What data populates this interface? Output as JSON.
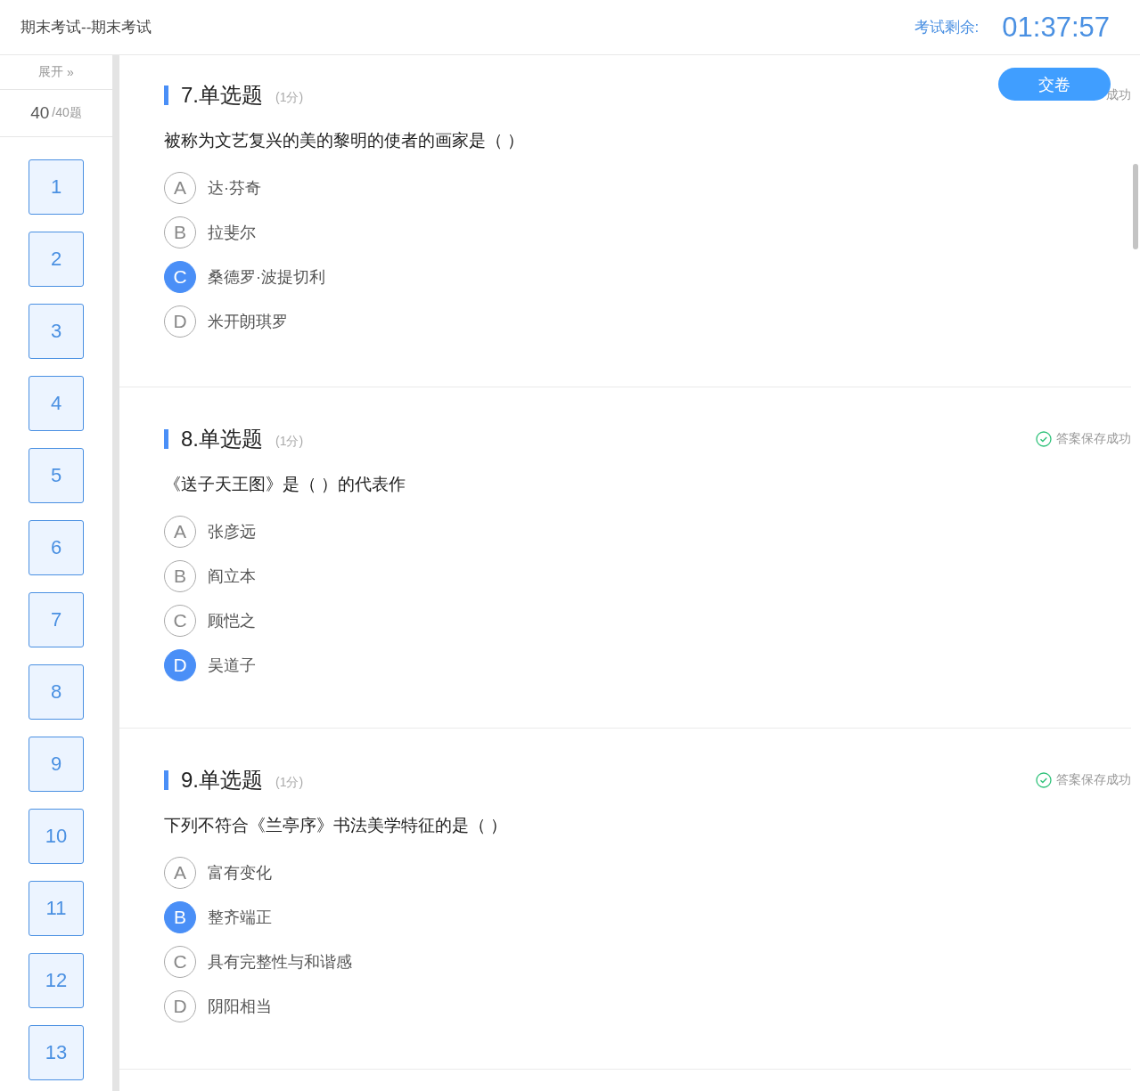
{
  "header": {
    "title": "期末考试--期末考试",
    "timer_label": "考试剩余:",
    "timer": "01:37:57"
  },
  "sidebar": {
    "expand": "展开",
    "expand_icon": "»",
    "answered": "40",
    "total": "/40题",
    "numbers": [
      "1",
      "2",
      "3",
      "4",
      "5",
      "6",
      "7",
      "8",
      "9",
      "10",
      "11",
      "12",
      "13"
    ]
  },
  "submit_button": "交卷",
  "questions": [
    {
      "title": "7.单选题",
      "score": "(1分)",
      "status": "成功",
      "status_icon": false,
      "text": "被称为文艺复兴的美的黎明的使者的画家是（ ）",
      "options": [
        {
          "letter": "A",
          "text": "达·芬奇",
          "selected": false
        },
        {
          "letter": "B",
          "text": "拉斐尔",
          "selected": false
        },
        {
          "letter": "C",
          "text": "桑德罗·波提切利",
          "selected": true
        },
        {
          "letter": "D",
          "text": "米开朗琪罗",
          "selected": false
        }
      ]
    },
    {
      "title": "8.单选题",
      "score": "(1分)",
      "status": "答案保存成功",
      "status_icon": true,
      "text": "《送子天王图》是（ ）的代表作",
      "options": [
        {
          "letter": "A",
          "text": "张彦远",
          "selected": false
        },
        {
          "letter": "B",
          "text": "阎立本",
          "selected": false
        },
        {
          "letter": "C",
          "text": "顾恺之",
          "selected": false
        },
        {
          "letter": "D",
          "text": "吴道子",
          "selected": true
        }
      ]
    },
    {
      "title": "9.单选题",
      "score": "(1分)",
      "status": "答案保存成功",
      "status_icon": true,
      "text": "下列不符合《兰亭序》书法美学特征的是（ ）",
      "options": [
        {
          "letter": "A",
          "text": "富有变化",
          "selected": false
        },
        {
          "letter": "B",
          "text": "整齐端正",
          "selected": true
        },
        {
          "letter": "C",
          "text": "具有完整性与和谐感",
          "selected": false
        },
        {
          "letter": "D",
          "text": "阴阳相当",
          "selected": false
        }
      ]
    }
  ]
}
